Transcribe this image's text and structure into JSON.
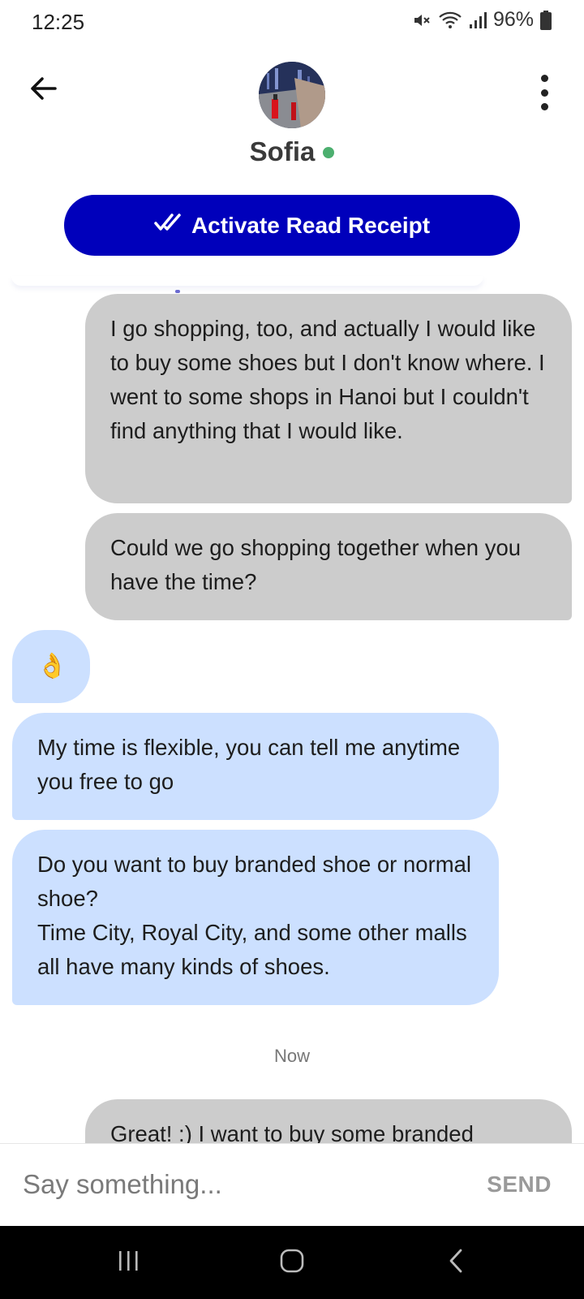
{
  "status_bar": {
    "time": "12:25",
    "battery": "96%"
  },
  "header": {
    "name": "Sofia",
    "read_receipt_label": "Activate Read Receipt"
  },
  "messages": [
    {
      "side": "out",
      "text": "I go shopping, too, and actually I would like to buy some shoes but I don't know where. I went to some shops in Hanoi but I couldn't find anything that I would like."
    },
    {
      "side": "out",
      "text": "Could we go shopping together when you have the time?"
    },
    {
      "side": "in",
      "text": "👌"
    },
    {
      "side": "in",
      "text": "My time is flexible, you can tell me anytime you free to go"
    },
    {
      "side": "in",
      "text": "Do you want to buy branded shoe or normal shoe?\nTime City, Royal City, and some other malls all have many kinds of shoes."
    },
    {
      "side": "out",
      "text": "Great! :) I want to buy some branded"
    }
  ],
  "time_divider": "Now",
  "composer": {
    "placeholder": "Say something...",
    "send_label": "SEND"
  },
  "colors": {
    "accent": "#0000bb",
    "outgoing_bubble": "#cccccc",
    "incoming_bubble": "#cce0ff",
    "online": "#4caf6f"
  }
}
